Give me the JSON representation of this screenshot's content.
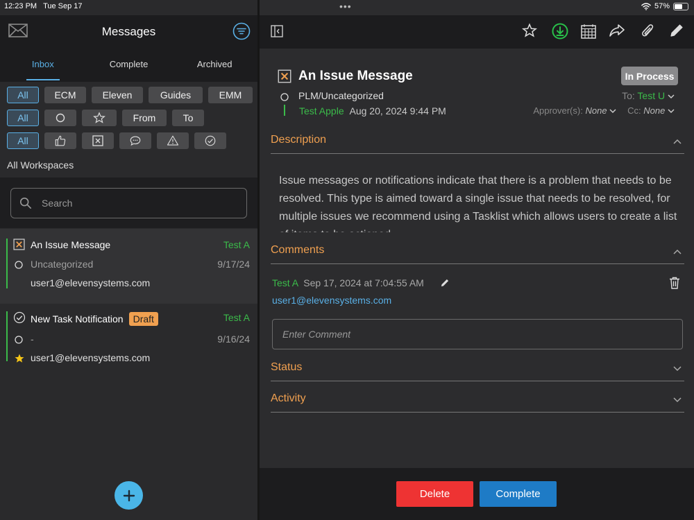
{
  "status_bar": {
    "time": "12:23 PM",
    "date": "Tue Sep 17",
    "battery": "57%"
  },
  "left": {
    "title": "Messages",
    "tabs": [
      {
        "label": "Inbox"
      },
      {
        "label": "Complete"
      },
      {
        "label": "Archived"
      }
    ],
    "workspace_chips": [
      "All",
      "ECM",
      "Eleven",
      "Guides",
      "EMM"
    ],
    "filter_chips": [
      "All",
      "From",
      "To"
    ],
    "type_chip_all": "All",
    "workspace_label": "All Workspaces",
    "search_placeholder": "Search",
    "messages": [
      {
        "title": "An Issue Message",
        "sender": "Test A",
        "category": "Uncategorized",
        "date": "9/17/24",
        "email": "user1@elevensystems.com"
      },
      {
        "title": "New Task Notification",
        "badge": "Draft",
        "sender": "Test A",
        "category": "-",
        "date": "9/16/24",
        "email": "user1@elevensystems.com"
      }
    ]
  },
  "detail": {
    "title": "An Issue Message",
    "status_badge": "In Process",
    "category": "PLM/Uncategorized",
    "to_label": "To:",
    "to_value": "Test U",
    "sender": "Test Apple",
    "sent_date": "Aug 20, 2024 9:44 PM",
    "approver_label": "Approver(s):",
    "approver_value": "None",
    "cc_label": "Cc:",
    "cc_value": "None",
    "description_label": "Description",
    "description_text": "Issue messages or notifications indicate that there is a problem that needs to be resolved. This type is aimed toward a single issue that needs to be resolved, for multiple issues we recommend using a Tasklist which allows users to create a list of items to be actioned.",
    "comments_label": "Comments",
    "comment": {
      "author": "Test A",
      "date": "Sep 17, 2024 at 7:04:55 AM",
      "email": "user1@elevensystems.com"
    },
    "comment_placeholder": "Enter Comment",
    "status_label": "Status",
    "activity_label": "Activity",
    "delete_label": "Delete",
    "complete_label": "Complete"
  },
  "colors": {
    "accent_blue": "#5ab0e6",
    "green": "#3bbb4a",
    "orange": "#f0a050",
    "delete": "#ee3333",
    "complete": "#1e7bc6"
  }
}
